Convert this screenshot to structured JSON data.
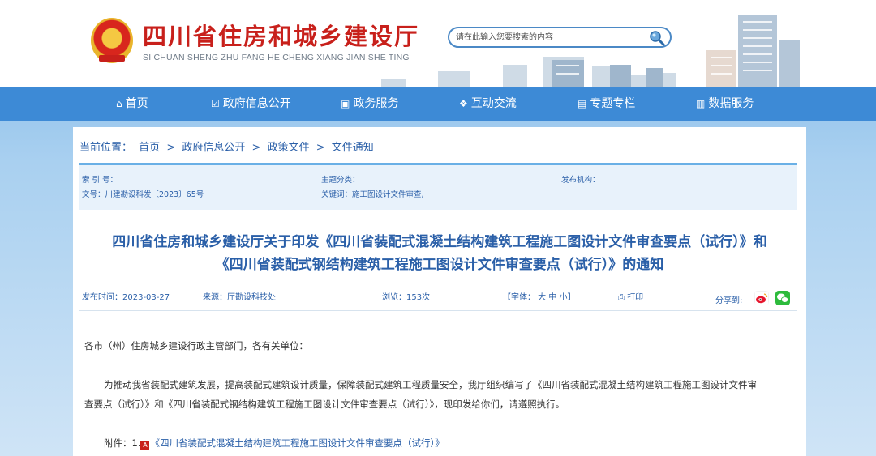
{
  "header": {
    "title": "四川省住房和城乡建设厅",
    "subtitle": "SI CHUAN SHENG ZHU FANG HE CHENG XIANG JIAN SHE TING",
    "search_placeholder": "请在此输入您要搜索的内容"
  },
  "nav": [
    {
      "icon": "home-icon",
      "glyph": "⌂",
      "label": "首页"
    },
    {
      "icon": "edit-icon",
      "glyph": "☑",
      "label": "政府信息公开"
    },
    {
      "icon": "monitor-icon",
      "glyph": "▣",
      "label": "政务服务"
    },
    {
      "icon": "chat-icon",
      "glyph": "❖",
      "label": "互动交流"
    },
    {
      "icon": "image-icon",
      "glyph": "▤",
      "label": "专题专栏"
    },
    {
      "icon": "chart-icon",
      "glyph": "▥",
      "label": "数据服务"
    }
  ],
  "breadcrumb": {
    "label": "当前位置：",
    "items": [
      "首页",
      ">",
      "政府信息公开",
      ">",
      "政策文件",
      ">",
      "文件通知"
    ]
  },
  "meta": {
    "index_label": "索 引 号：",
    "doc_no": "文号：川建勘设科发〔2023〕65号",
    "topic_label": "主题分类：",
    "keywords": "关键词：施工图设计文件审查,",
    "publisher_label": "发布机构："
  },
  "article": {
    "title_line1": "四川省住房和城乡建设厅关于印发《四川省装配式混凝土结构建筑工程施工图设计文件审查要点（试行）》和",
    "title_line2": "《四川省装配式钢结构建筑工程施工图设计文件审查要点（试行）》的通知",
    "date": "发布时间：2023-03-27",
    "source": "来源：厅勘设科技处",
    "views": "浏览：153次",
    "font_size": "【字体： 大 中 小】",
    "print": "打印",
    "share": "分享到:",
    "greeting": "各市（州）住房城乡建设行政主管部门，各有关单位：",
    "para1_line1": "为推动我省装配式建筑发展，提高装配式建筑设计质量，保障装配式建筑工程质量安全，我厅组织编写了《四川省装配式混凝土结构建筑工程施工图设计文件审",
    "para1_line2": "查要点（试行）》和《四川省装配式钢结构建筑工程施工图设计文件审查要点（试行）》，现印发给你们，请遵照执行。",
    "attach_label": "附件：1.",
    "attach_link": "《四川省装配式混凝土结构建筑工程施工图设计文件审查要点（试行）》"
  }
}
